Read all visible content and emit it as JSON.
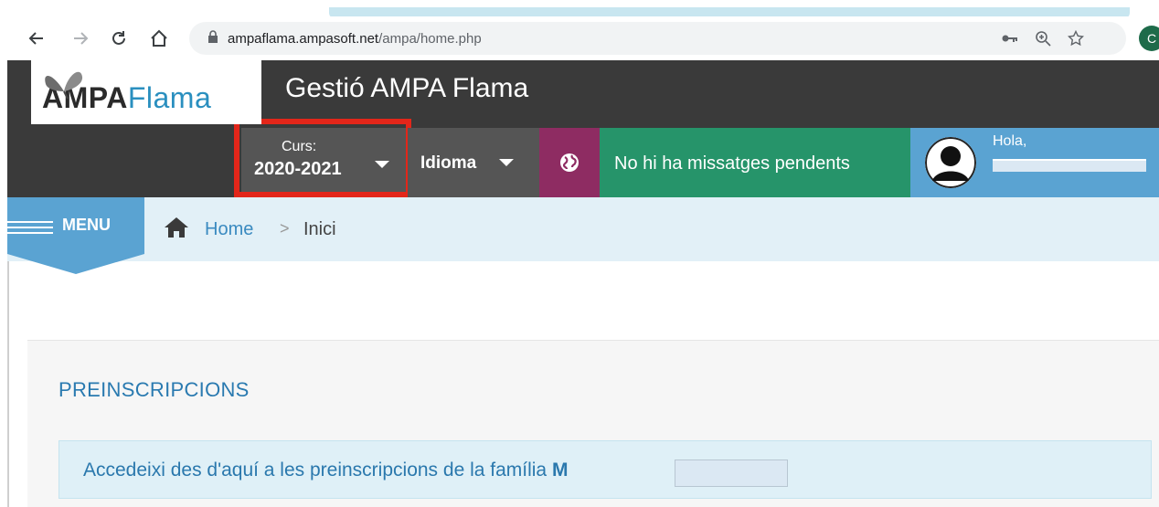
{
  "browser": {
    "url_host": "ampaflama.ampasoft.net",
    "url_path": "/ampa/home.php",
    "profile_initial": "C"
  },
  "header": {
    "logo_bold": "AMPA",
    "logo_light": "Flama",
    "title": "Gestió AMPA Flama"
  },
  "topnav": {
    "curs_label": "Curs:",
    "curs_value": "2020-2021",
    "idioma_label": "Idioma",
    "messages_label": "No hi ha missatges pendents",
    "greeting": "Hola,"
  },
  "menu": {
    "label": "MENU"
  },
  "breadcrumb": {
    "home": "Home",
    "separator": ">",
    "current": "Inici"
  },
  "main": {
    "section_title": "PREINSCRIPCIONS",
    "alert_text": "Accedeixi des d'aquí a les preinscripcions de la família ",
    "alert_family_visible": "M"
  },
  "colors": {
    "dark_bar": "#3a3a3a",
    "highlight": "#e3261a",
    "globe_bg": "#8e2c62",
    "messages_bg": "#26946a",
    "user_bg": "#5aa3d2",
    "link": "#2a78ad"
  }
}
